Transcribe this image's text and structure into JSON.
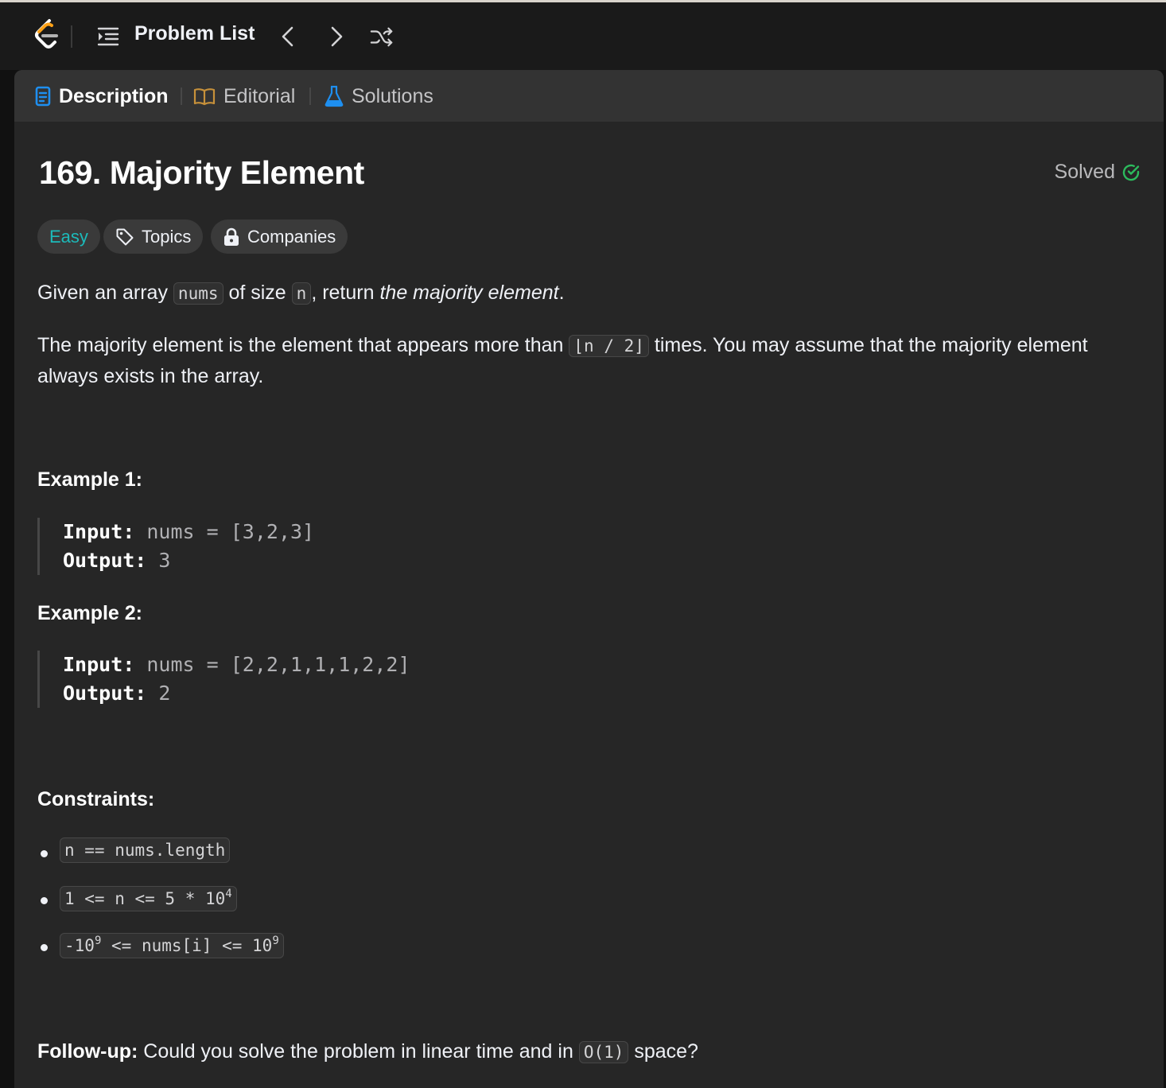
{
  "topbar": {
    "problem_list_label": "Problem List"
  },
  "tabs": [
    {
      "label": "Description",
      "active": true
    },
    {
      "label": "Editorial",
      "active": false
    },
    {
      "label": "Solutions",
      "active": false
    }
  ],
  "problem": {
    "title": "169. Majority Element",
    "status": "Solved",
    "difficulty": "Easy",
    "topics_label": "Topics",
    "companies_label": "Companies"
  },
  "description": {
    "p1_a": "Given an array ",
    "p1_code1": "nums",
    "p1_b": " of size ",
    "p1_code2": "n",
    "p1_c": ", return ",
    "p1_em": "the majority element",
    "p1_d": ".",
    "p2_a": "The majority element is the element that appears more than ",
    "p2_code": "⌊n / 2⌋",
    "p2_b": " times. You may assume that the majority element always exists in the array."
  },
  "examples": [
    {
      "heading": "Example 1:",
      "input_label": "Input:",
      "input_value": "nums = [3,2,3]",
      "output_label": "Output:",
      "output_value": "3"
    },
    {
      "heading": "Example 2:",
      "input_label": "Input:",
      "input_value": "nums = [2,2,1,1,1,2,2]",
      "output_label": "Output:",
      "output_value": "2"
    }
  ],
  "constraints": {
    "heading": "Constraints:",
    "c1": "n == nums.length",
    "c2_a": "1 <= n <= 5 * 10",
    "c2_sup": "4",
    "c3_a": "-10",
    "c3_sup1": "9",
    "c3_b": " <= nums[i] <= 10",
    "c3_sup2": "9"
  },
  "followup": {
    "label": "Follow-up:",
    "text_a": " Could you solve the problem in linear time and in ",
    "code": "O(1)",
    "text_b": " space?"
  },
  "colors": {
    "easy": "#1cbaba",
    "solved_check": "#2cbb5d",
    "description_icon": "#1e8ff0",
    "editorial_icon": "#c7913a",
    "solutions_icon": "#1e8ff0"
  }
}
